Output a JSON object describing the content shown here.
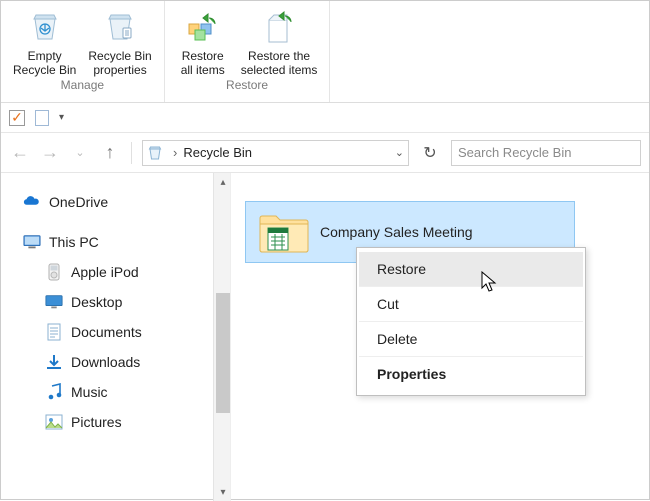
{
  "ribbon": {
    "groups": [
      {
        "title": "Manage",
        "items": [
          {
            "label": "Empty\nRecycle Bin",
            "icon": "recycle-bin-empty-icon"
          },
          {
            "label": "Recycle Bin\nproperties",
            "icon": "recycle-bin-properties-icon"
          }
        ]
      },
      {
        "title": "Restore",
        "items": [
          {
            "label": "Restore\nall items",
            "icon": "restore-all-icon"
          },
          {
            "label": "Restore the\nselected items",
            "icon": "restore-selected-icon"
          }
        ]
      }
    ]
  },
  "address": {
    "location": "Recycle Bin"
  },
  "search": {
    "placeholder": "Search Recycle Bin"
  },
  "sidebar": {
    "items": [
      {
        "label": "OneDrive",
        "icon": "onedrive-icon",
        "level": 0
      },
      {
        "label": "This PC",
        "icon": "this-pc-icon",
        "level": 0
      },
      {
        "label": "Apple iPod",
        "icon": "ipod-icon",
        "level": 1
      },
      {
        "label": "Desktop",
        "icon": "desktop-icon",
        "level": 1
      },
      {
        "label": "Documents",
        "icon": "documents-icon",
        "level": 1
      },
      {
        "label": "Downloads",
        "icon": "downloads-icon",
        "level": 1
      },
      {
        "label": "Music",
        "icon": "music-icon",
        "level": 1
      },
      {
        "label": "Pictures",
        "icon": "pictures-icon",
        "level": 1
      }
    ]
  },
  "file": {
    "name": "Company Sales Meeting"
  },
  "context_menu": {
    "items": [
      {
        "label": "Restore",
        "hover": true
      },
      {
        "label": "Cut"
      },
      {
        "label": "Delete"
      },
      {
        "label": "Properties"
      }
    ]
  }
}
